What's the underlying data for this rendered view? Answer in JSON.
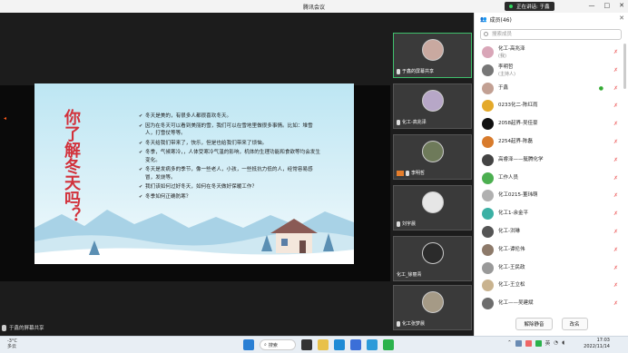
{
  "window": {
    "title": "腾讯会议",
    "speaking": "正在讲话: 于鑫",
    "controls": [
      "—",
      "□",
      "✕"
    ]
  },
  "slide": {
    "title": "你了解冬天吗？",
    "bullets": [
      "冬天是美的，有很多人都很喜欢冬天。",
      "因为在冬天可以看到美丽的雪，我们可以在雪地里做很多事情。比如：堆雪人，打雪仗等等。",
      "冬天给我们带来了，快乐，但是也给我们带来了烦恼。",
      "冬季，气候寒冷，，人体受寒冷气温的影响，机体的生理功能和食欲等均会发生变化。",
      "冬天是发病多的季节，像一些老人，小孩，一些抵抗力低的人，经常容易感冒，发烧等。",
      "我们该如何过好冬天，如何在冬天做好保暖工作？",
      "冬季如何正确防寒？"
    ]
  },
  "stage": {
    "share_label": "于鑫的屏幕共享"
  },
  "tiles": [
    {
      "label": "于鑫的屏幕共享"
    },
    {
      "label": "化工-高兆泽"
    },
    {
      "label": "李明哲"
    },
    {
      "label": "刘宇晨"
    },
    {
      "label": "化工_徐丽青"
    },
    {
      "label": "化工张梦晨"
    }
  ],
  "panel": {
    "header": "成员(46)",
    "search_placeholder": "搜索成员",
    "members": [
      {
        "name": "化工-高兆泽",
        "role": "(我)"
      },
      {
        "name": "李明哲",
        "role": "(主持人)"
      },
      {
        "name": "于鑫",
        "role": ""
      },
      {
        "name": "0233化二-陈红雨",
        "role": ""
      },
      {
        "name": "2058起界-吴佳豪",
        "role": ""
      },
      {
        "name": "2254起界-陈磊",
        "role": ""
      },
      {
        "name": "高睿泽——艇腾化学",
        "role": ""
      },
      {
        "name": "工作人员",
        "role": ""
      },
      {
        "name": "化工0215-董玮萌",
        "role": ""
      },
      {
        "name": "化工1-余金平",
        "role": ""
      },
      {
        "name": "化工-洪琳",
        "role": ""
      },
      {
        "name": "化工-谭伦伟",
        "role": ""
      },
      {
        "name": "化工-王民政",
        "role": ""
      },
      {
        "name": "化工-王立松",
        "role": ""
      },
      {
        "name": "化工——吴建斌",
        "role": ""
      }
    ],
    "mute_all": "解除静音",
    "rename": "改名"
  },
  "taskbar": {
    "weather_temp": "-3°C",
    "weather_desc": "多云",
    "search_label": "搜索",
    "ime": "英",
    "time": "17:03",
    "date": "2022/11/14"
  },
  "colors": {
    "slide_title": "#d2313b",
    "active_tile": "#3fbf6c",
    "mute_icon": "#e66666"
  }
}
